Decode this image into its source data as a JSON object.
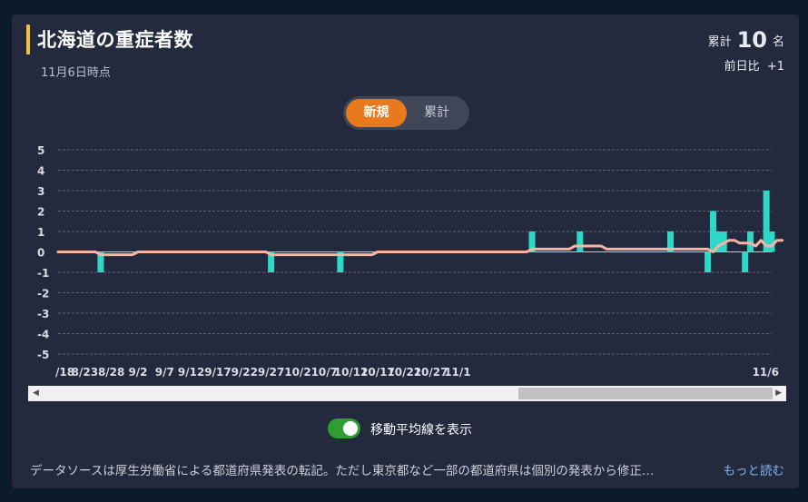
{
  "header": {
    "title": "北海道の重症者数",
    "subtitle": "11月6日時点",
    "total_label": "累計",
    "total_value": "10",
    "total_unit": "名",
    "diff_label": "前日比",
    "diff_value": "+1"
  },
  "toggle": {
    "new_label": "新規",
    "cumulative_label": "累計",
    "selected": "新規"
  },
  "colors": {
    "bar": "#2ed8c6",
    "avg_line": "#f6b5a4",
    "accent": "#e8791d",
    "switch_on": "#2e9e34",
    "title_bar": "#f2c230"
  },
  "switch": {
    "label": "移動平均線を表示",
    "on": true
  },
  "footer": {
    "note": "データソースは厚生労働省による都道府県発表の転記。ただし東京都など一部の都道府県は個別の発表から修正…",
    "more_label": "もっと読む"
  },
  "chart_data": {
    "type": "bar",
    "ylim": [
      -5,
      5
    ],
    "yticks": [
      "5",
      "4",
      "3",
      "2",
      "1",
      "0",
      "-1",
      "-2",
      "-3",
      "-4",
      "-5"
    ],
    "xtick_labels": [
      "/18",
      "8/23",
      "8/28",
      "9/2",
      "9/7",
      "9/12",
      "9/17",
      "9/22",
      "9/27",
      "10/2",
      "10/7",
      "10/12",
      "10/17",
      "10/22",
      "10/27",
      "11/1",
      "11/6"
    ],
    "start_date": "8/18",
    "values": [
      0,
      0,
      0,
      0,
      0,
      0,
      0,
      0,
      -1,
      0,
      0,
      0,
      0,
      0,
      0,
      0,
      0,
      0,
      0,
      0,
      0,
      0,
      0,
      0,
      0,
      0,
      0,
      0,
      0,
      0,
      0,
      0,
      0,
      0,
      0,
      0,
      0,
      0,
      0,
      0,
      -1,
      0,
      0,
      0,
      0,
      0,
      0,
      0,
      0,
      0,
      0,
      0,
      0,
      -1,
      0,
      0,
      0,
      0,
      0,
      0,
      0,
      0,
      0,
      0,
      0,
      0,
      0,
      0,
      0,
      0,
      0,
      0,
      0,
      0,
      0,
      0,
      0,
      0,
      0,
      0,
      0,
      0,
      0,
      0,
      0,
      0,
      0,
      0,
      0,
      1,
      0,
      0,
      0,
      0,
      0,
      0,
      0,
      0,
      1,
      0,
      0,
      0,
      0,
      0,
      0,
      0,
      0,
      0,
      0,
      0,
      0,
      0,
      0,
      0,
      0,
      1,
      0,
      0,
      0,
      0,
      0,
      0,
      -1,
      2,
      1,
      1,
      0,
      0,
      0,
      -1,
      1,
      0,
      0,
      3,
      1
    ],
    "moving_average": [
      0,
      0,
      0,
      0,
      0,
      0,
      0,
      0,
      -0.14,
      -0.14,
      -0.14,
      -0.14,
      -0.14,
      -0.14,
      -0.14,
      0,
      0,
      0,
      0,
      0,
      0,
      0,
      0,
      0,
      0,
      0,
      0,
      0,
      0,
      0,
      0,
      0,
      0,
      0,
      0,
      0,
      0,
      0,
      0,
      0,
      -0.14,
      -0.14,
      -0.14,
      -0.14,
      -0.14,
      -0.14,
      -0.14,
      -0.14,
      -0.14,
      -0.14,
      -0.14,
      -0.14,
      -0.14,
      -0.14,
      -0.14,
      -0.14,
      -0.14,
      -0.14,
      -0.14,
      -0.14,
      0,
      0,
      0,
      0,
      0,
      0,
      0,
      0,
      0,
      0,
      0,
      0,
      0,
      0,
      0,
      0,
      0,
      0,
      0,
      0,
      0,
      0,
      0,
      0,
      0,
      0,
      0,
      0,
      0,
      0.14,
      0.14,
      0.14,
      0.14,
      0.14,
      0.14,
      0.14,
      0.14,
      0.29,
      0.29,
      0.29,
      0.29,
      0.29,
      0.29,
      0.14,
      0.14,
      0.14,
      0.14,
      0.14,
      0.14,
      0.14,
      0.14,
      0.14,
      0.14,
      0.14,
      0.14,
      0.14,
      0.14,
      0.14,
      0.14,
      0.14,
      0.14,
      0.14,
      0.14,
      0,
      0.29,
      0.43,
      0.57,
      0.57,
      0.43,
      0.43,
      0.43,
      0.29,
      0.57,
      0.29,
      0.29,
      0.57,
      0.57
    ]
  }
}
